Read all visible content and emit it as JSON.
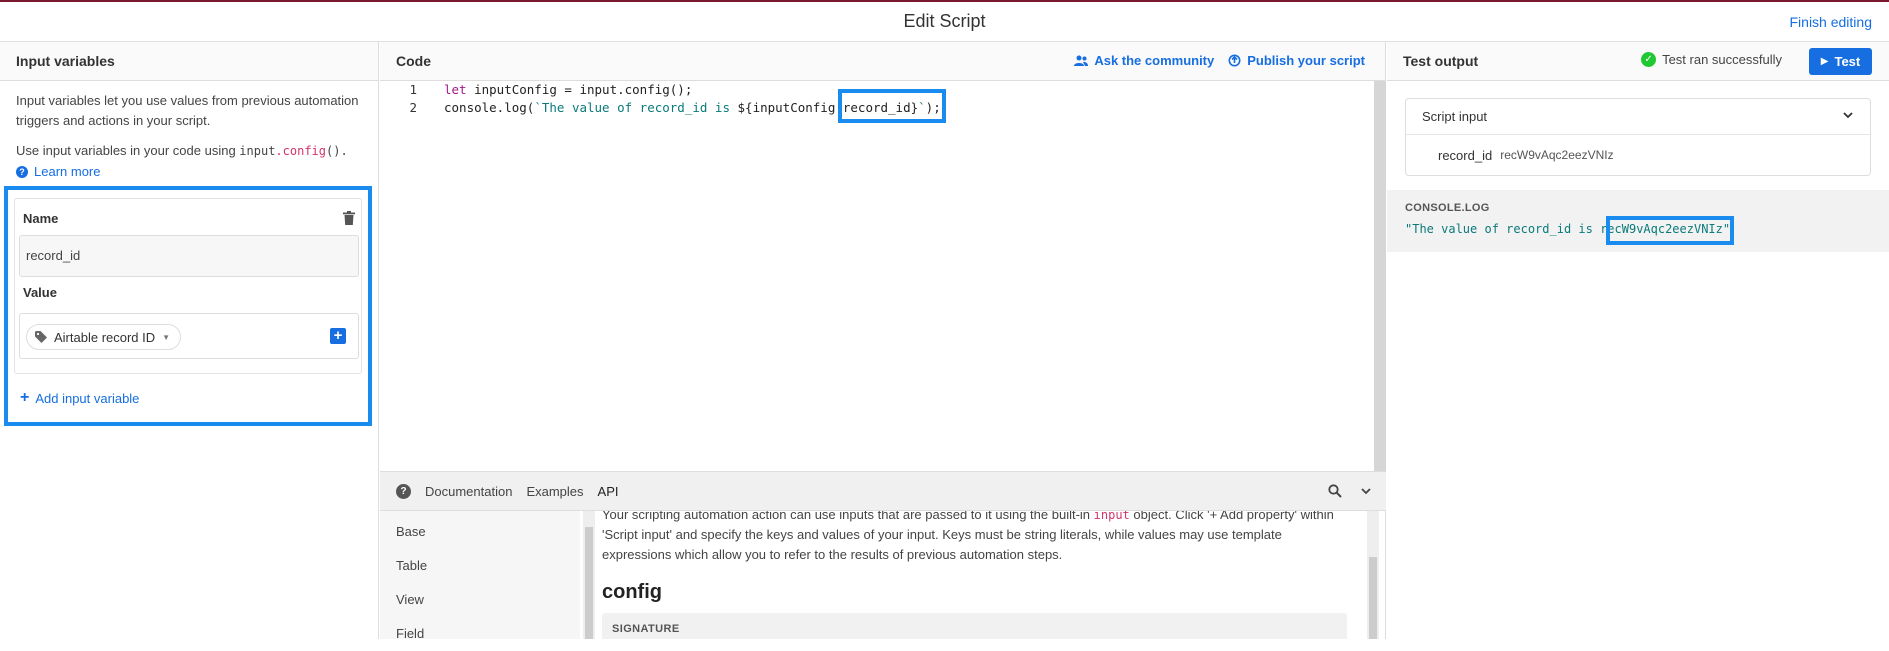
{
  "header": {
    "title": "Edit Script",
    "finish_label": "Finish editing"
  },
  "input_panel": {
    "title": "Input variables",
    "description": "Input variables let you use values from previous automation triggers and actions in your script.",
    "usage_prefix": "Use input variables in your code using ",
    "usage_code_a": "input",
    "usage_code_b": ".config",
    "usage_code_c": "().",
    "learn_more": "Learn more",
    "variable": {
      "name_label": "Name",
      "name_value": "record_id",
      "value_label": "Value",
      "value_token": "Airtable record ID"
    },
    "add_label": "Add input variable"
  },
  "code_panel": {
    "title": "Code",
    "ask_community": "Ask the community",
    "publish": "Publish your script",
    "lines": [
      {
        "num": "1",
        "kw": "let",
        "rest": " inputConfig = input.config();"
      },
      {
        "num": "2",
        "pre": "console.log(",
        "str": "`The value of record_id is ",
        "interp": "${inputConfig.record_id}",
        "strend": "`",
        "post": ");"
      }
    ]
  },
  "docs": {
    "tabs": [
      "Documentation",
      "Examples",
      "API"
    ],
    "nav": [
      "Base",
      "Table",
      "View",
      "Field"
    ],
    "para_a": "Your scripting automation action can use inputs that are passed to it using the built-in ",
    "para_code": "input",
    "para_b": " object. Click '+ Add property' within 'Script input' and specify the keys and values of your input. Keys must be string literals, while values may use template expressions which allow you to refer to the results of previous automation steps.",
    "heading": "config",
    "signature_label": "SIGNATURE"
  },
  "test_panel": {
    "title": "Test output",
    "status": "Test ran successfully",
    "test_button": "Test",
    "script_input_label": "Script input",
    "input_key": "record_id",
    "input_value": "recW9vAqc2eezVNIz",
    "console_label": "CONSOLE.LOG",
    "console_output": "\"The value of record_id is recW9vAqc2eezVNIz\""
  },
  "colors": {
    "accent": "#166ee1",
    "highlight": "#1a8cf0",
    "success": "#20c933"
  }
}
